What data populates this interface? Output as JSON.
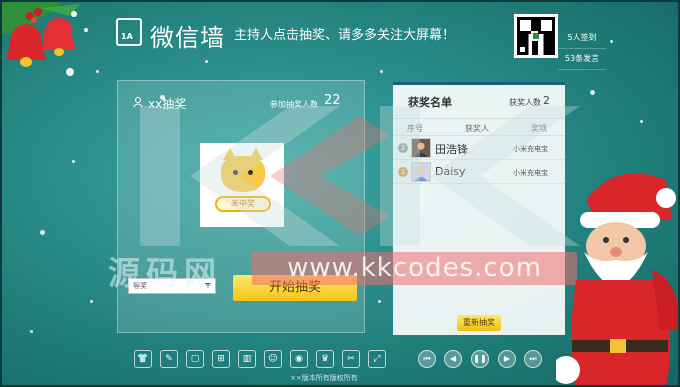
{
  "header": {
    "logo_num": "1A",
    "app_title": "微信墙",
    "marquee": "主持人点击抽奖、请多多关注大屏幕！",
    "stats": [
      "5人签到",
      "53条发言"
    ]
  },
  "lottery": {
    "title": "xx抽奖",
    "participants_label": "参加抽奖人数",
    "participants_count": "22",
    "badge": "未中奖",
    "select_value": "等奖",
    "start_button": "开始抽奖"
  },
  "winners": {
    "title": "获奖名单",
    "count_label": "获奖人数",
    "count": "2",
    "columns": [
      "序号",
      "获奖人",
      "奖项"
    ],
    "rows": [
      {
        "index": "2",
        "name": "田浩锋",
        "prize": "小米充电宝"
      },
      {
        "index": "1",
        "name": "Daisy",
        "prize": "小米充电宝"
      }
    ],
    "redraw_button": "重新抽奖"
  },
  "watermark": {
    "cn": "源码网",
    "url": "www.kkcodes.com"
  },
  "toolbar": {
    "icons": [
      "shirt-icon",
      "pen-icon",
      "frame-icon",
      "gift-icon",
      "chart-icon",
      "users-icon",
      "disc-icon",
      "cup-icon",
      "ticket-icon",
      "fullscreen-icon"
    ],
    "player": [
      "first-icon",
      "prev-icon",
      "pause-icon",
      "next-icon",
      "last-icon"
    ]
  },
  "footer": "××版本所有版权所有",
  "colors": {
    "background": "#23837f",
    "accent_yellow": "#f5c518",
    "watermark_red": "#f06e6e"
  }
}
